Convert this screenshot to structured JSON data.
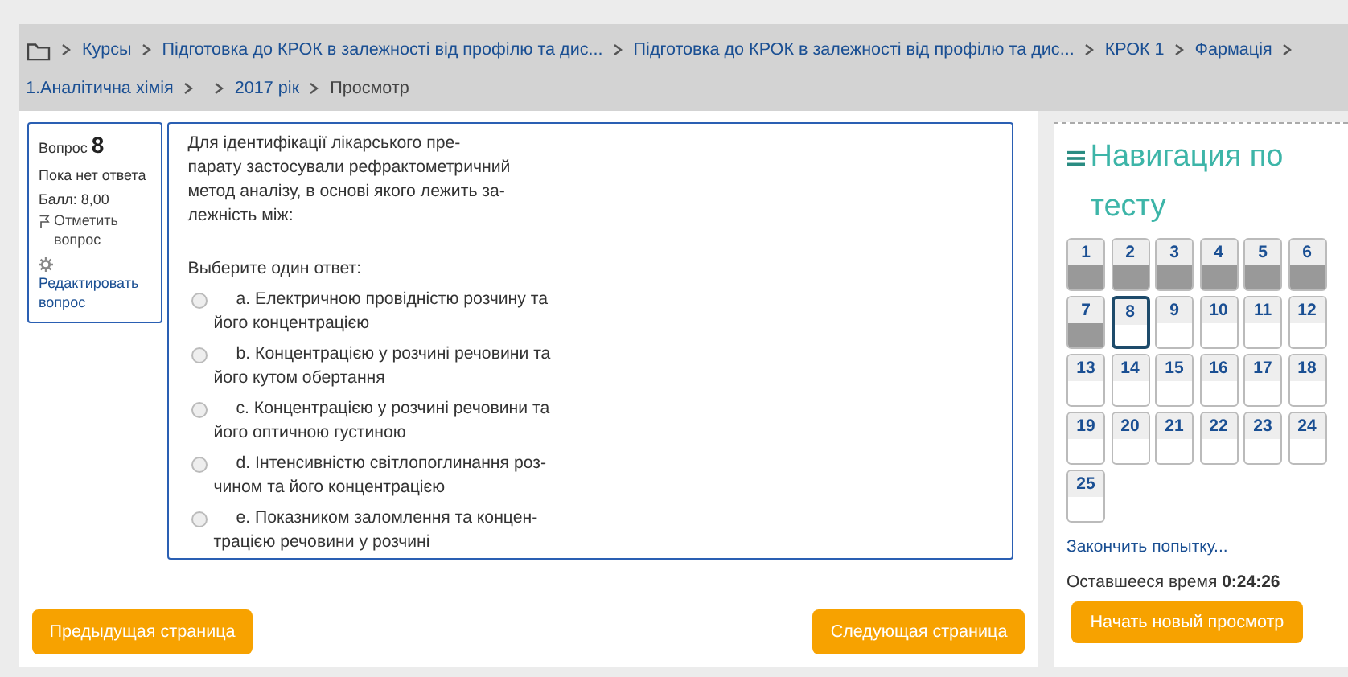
{
  "breadcrumb": [
    {
      "kind": "link",
      "label": "Курсы"
    },
    {
      "kind": "link",
      "label": "Підготовка до КРОК в залежності від профілю та дис..."
    },
    {
      "kind": "link",
      "label": "Підготовка до КРОК в залежності від профілю та дис..."
    },
    {
      "kind": "link",
      "label": "КРОК 1"
    },
    {
      "kind": "link",
      "label": "Фармація"
    },
    {
      "kind": "link",
      "label": "1.Аналітична хімія"
    },
    {
      "kind": "gap"
    },
    {
      "kind": "link",
      "label": "2017 рік"
    },
    {
      "kind": "current",
      "label": "Просмотр"
    }
  ],
  "question_info": {
    "label": "Вопрос",
    "number": "8",
    "state": "Пока нет ответа",
    "grade": "Балл: 8,00",
    "flag": "Отметить вопрос",
    "edit": "Редактировать вопрос"
  },
  "question": {
    "text_lines": [
      "Для ідентифікації лікарського пре-",
      "парату застосували рефрактометричний",
      "метод аналізу, в основі якого лежить за-",
      "лежність між:"
    ],
    "prompt": "Выберите один ответ:",
    "options": [
      {
        "lines": [
          "a. Електричною провідністю розчину та",
          "його концентрацією"
        ],
        "selected": false
      },
      {
        "lines": [
          "b. Концентрацією у розчині речовини та",
          "його кутом обертання"
        ],
        "selected": false
      },
      {
        "lines": [
          "c. Концентрацією у розчині речовини та",
          "його оптичною густиною"
        ],
        "selected": false
      },
      {
        "lines": [
          "d. Інтенсивністю світлопоглинання роз-",
          "чином та його концентрацією"
        ],
        "selected": false
      },
      {
        "lines": [
          "e. Показником заломлення та концен-",
          "трацією речовини у розчині"
        ],
        "selected": false
      }
    ]
  },
  "buttons": {
    "previous": "Предыдущая страница",
    "next": "Следующая страница"
  },
  "navigation": {
    "title": "Навигация по тесту",
    "questions": [
      {
        "label": "1",
        "answered": true,
        "selected": false
      },
      {
        "label": "2",
        "answered": true,
        "selected": false
      },
      {
        "label": "3",
        "answered": true,
        "selected": false
      },
      {
        "label": "4",
        "answered": true,
        "selected": false
      },
      {
        "label": "5",
        "answered": true,
        "selected": false
      },
      {
        "label": "6",
        "answered": true,
        "selected": false
      },
      {
        "label": "7",
        "answered": true,
        "selected": false
      },
      {
        "label": "8",
        "answered": false,
        "selected": true
      },
      {
        "label": "9",
        "answered": false,
        "selected": false
      },
      {
        "label": "10",
        "answered": false,
        "selected": false
      },
      {
        "label": "11",
        "answered": false,
        "selected": false
      },
      {
        "label": "12",
        "answered": false,
        "selected": false
      },
      {
        "label": "13",
        "answered": false,
        "selected": false
      },
      {
        "label": "14",
        "answered": false,
        "selected": false
      },
      {
        "label": "15",
        "answered": false,
        "selected": false
      },
      {
        "label": "16",
        "answered": false,
        "selected": false
      },
      {
        "label": "17",
        "answered": false,
        "selected": false
      },
      {
        "label": "18",
        "answered": false,
        "selected": false
      },
      {
        "label": "19",
        "answered": false,
        "selected": false
      },
      {
        "label": "20",
        "answered": false,
        "selected": false
      },
      {
        "label": "21",
        "answered": false,
        "selected": false
      },
      {
        "label": "22",
        "answered": false,
        "selected": false
      },
      {
        "label": "23",
        "answered": false,
        "selected": false
      },
      {
        "label": "24",
        "answered": false,
        "selected": false
      },
      {
        "label": "25",
        "answered": false,
        "selected": false
      }
    ],
    "finish": "Закончить попытку...",
    "time_label": "Оставшееся время",
    "time": "0:24:26",
    "new_preview": "Начать новый просмотр"
  }
}
